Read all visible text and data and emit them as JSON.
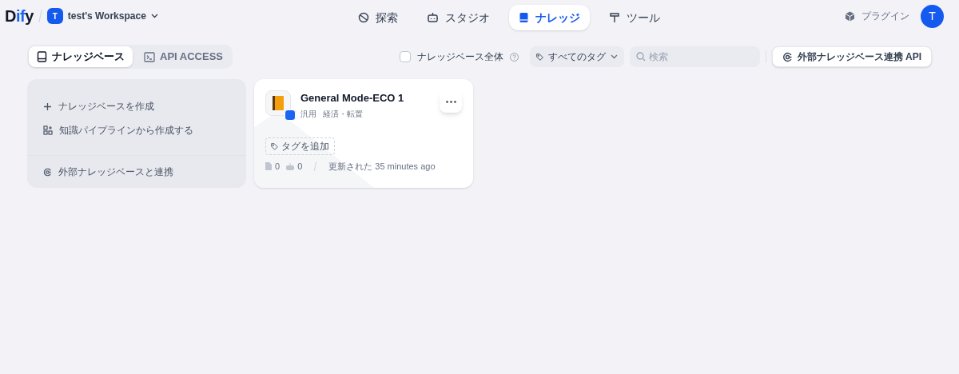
{
  "header": {
    "logo": "Dify",
    "workspace": {
      "avatar": "T",
      "name": "test's Workspace"
    },
    "nav": [
      {
        "label": "探索",
        "selected": false
      },
      {
        "label": "スタジオ",
        "selected": false
      },
      {
        "label": "ナレッジ",
        "selected": true
      },
      {
        "label": "ツール",
        "selected": false
      }
    ],
    "plugin": "プラグイン",
    "avatar": "T"
  },
  "tabs": [
    {
      "label": "ナレッジベース",
      "selected": true
    },
    {
      "label": "API ACCESS",
      "selected": false
    }
  ],
  "toolbar": {
    "all_knowledge": {
      "label": "ナレッジベース全体",
      "checked": false
    },
    "tag_filter": "すべてのタグ",
    "search": {
      "placeholder": "検索"
    },
    "external_api": "外部ナレッジベース連携 API"
  },
  "create_card": {
    "actions": [
      {
        "label": "ナレッジベースを作成"
      },
      {
        "label": "知識パイプラインから作成する"
      }
    ],
    "external": "外部ナレッジベースと連携"
  },
  "datasets": [
    {
      "name": "General Mode-ECO 1",
      "meta": [
        "汎用",
        "経済・転置"
      ],
      "add_tag": "タグを追加",
      "docs": "0",
      "apps": "0",
      "updated": "更新された 35 minutes ago"
    }
  ]
}
